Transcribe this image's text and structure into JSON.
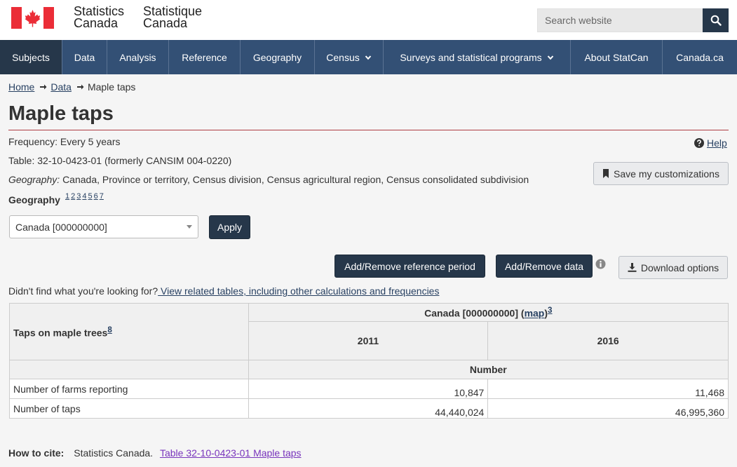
{
  "header": {
    "brand_en_line1": "Statistics",
    "brand_en_line2": "Canada",
    "brand_fr_line1": "Statistique",
    "brand_fr_line2": "Canada",
    "search_placeholder": "Search website"
  },
  "nav": {
    "subjects": "Subjects",
    "data": "Data",
    "analysis": "Analysis",
    "reference": "Reference",
    "geography": "Geography",
    "census": "Census",
    "surveys": "Surveys and statistical programs",
    "about": "About StatCan",
    "canada_ca": "Canada.ca"
  },
  "breadcrumb": {
    "home": "Home",
    "data": "Data",
    "current": "Maple taps"
  },
  "page": {
    "title": "Maple taps",
    "frequency": "Frequency: Every 5 years",
    "table": "Table: 32-10-0423-01 (formerly CANSIM 004-0220)",
    "geography_label": "Geography:",
    "geography_value": "Canada, Province or territory, Census division, Census agricultural region, Census consolidated subdivision",
    "help": "Help",
    "save": "Save my customizations"
  },
  "filter": {
    "label": "Geography",
    "links": [
      "1",
      "2",
      "3",
      "4",
      "5",
      "6",
      "7"
    ],
    "selected": "Canada [000000000]",
    "apply": "Apply"
  },
  "actions": {
    "ref_period": "Add/Remove reference period",
    "add_data": "Add/Remove data",
    "download": "Download options"
  },
  "related": {
    "prefix": "Didn't find what you're looking for?",
    "link": " View related tables, including other calculations and frequencies"
  },
  "table": {
    "row_header": "Taps on maple trees",
    "row_header_note": "8",
    "geo_header": "Canada [000000000]",
    "map_link": "map",
    "geo_note": "3",
    "years": [
      "2011",
      "2016"
    ],
    "unit": "Number",
    "rows": [
      {
        "label": "Number of farms reporting",
        "values": [
          "10,847",
          "11,468"
        ]
      },
      {
        "label": "Number of taps",
        "values": [
          "44,440,024",
          "46,995,360"
        ]
      }
    ]
  },
  "cite": {
    "label": "How to cite:",
    "text": "Statistics Canada.",
    "link": "Table  32-10-0423-01   Maple taps"
  },
  "colors": {
    "nav_bg": "#335075",
    "nav_active": "#26374a",
    "title_rule": "#af3c43",
    "flag_red": "#eb2d37"
  }
}
